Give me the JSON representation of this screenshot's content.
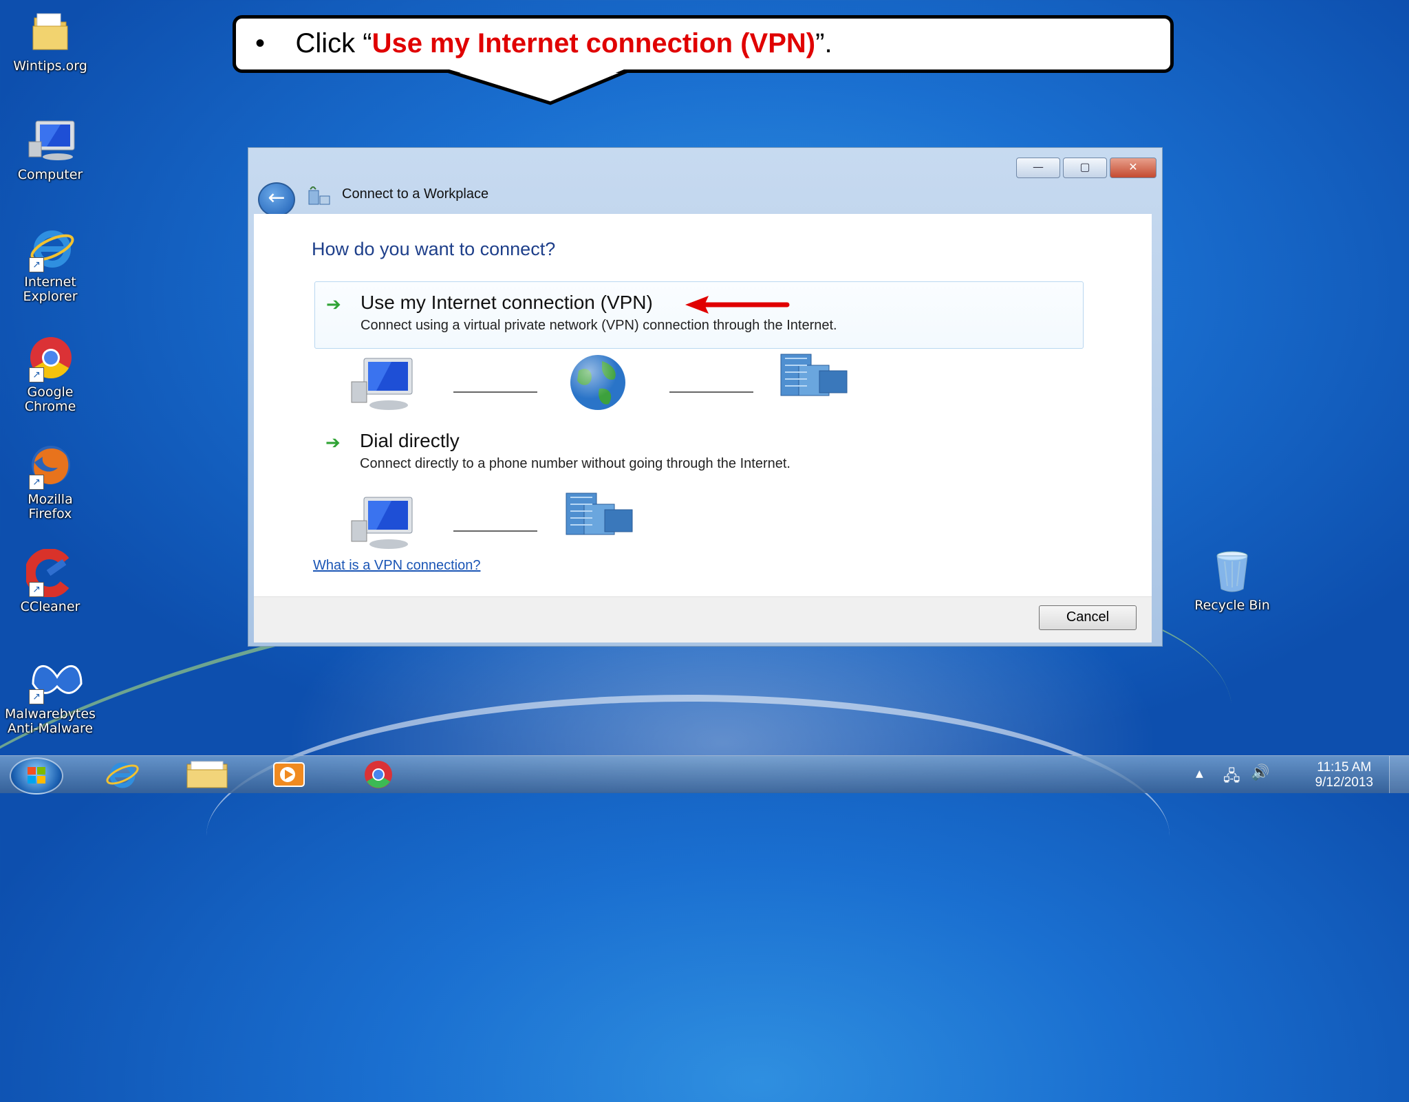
{
  "callout": {
    "bullet": "•",
    "prefix": "Click “",
    "highlight": "Use my Internet connection (VPN)",
    "suffix": "”."
  },
  "desktop_icons": [
    {
      "label": "Wintips.org",
      "icon": "folder-icon"
    },
    {
      "label": "Computer",
      "icon": "computer-icon"
    },
    {
      "label": "Internet Explorer",
      "icon": "internet-explorer-icon"
    },
    {
      "label": "Google Chrome",
      "icon": "chrome-icon"
    },
    {
      "label": "Mozilla Firefox",
      "icon": "firefox-icon"
    },
    {
      "label": "CCleaner",
      "icon": "ccleaner-icon"
    },
    {
      "label": "Malwarebytes Anti-Malware",
      "icon": "malwarebytes-icon"
    },
    {
      "label": "Recycle Bin",
      "icon": "recycle-bin-icon"
    }
  ],
  "dialog": {
    "title": "Connect to a Workplace",
    "heading": "How do you want to connect?",
    "options": [
      {
        "title": "Use my Internet connection (VPN)",
        "description": "Connect using a virtual private network (VPN) connection through the Internet."
      },
      {
        "title": "Dial directly",
        "description": "Connect directly to a phone number without going through the Internet."
      }
    ],
    "help_link": "What is a VPN connection?",
    "cancel_label": "Cancel"
  },
  "taskbar": {
    "clock_time": "11:15 AM",
    "clock_date": "9/12/2013",
    "pinned": [
      "internet-explorer-icon",
      "file-explorer-icon",
      "media-player-icon",
      "chrome-icon"
    ]
  },
  "colors": {
    "callout_highlight": "#e00000",
    "heading": "#1e3f8a",
    "link": "#1a55b5",
    "green_arrow": "#2fa334"
  }
}
